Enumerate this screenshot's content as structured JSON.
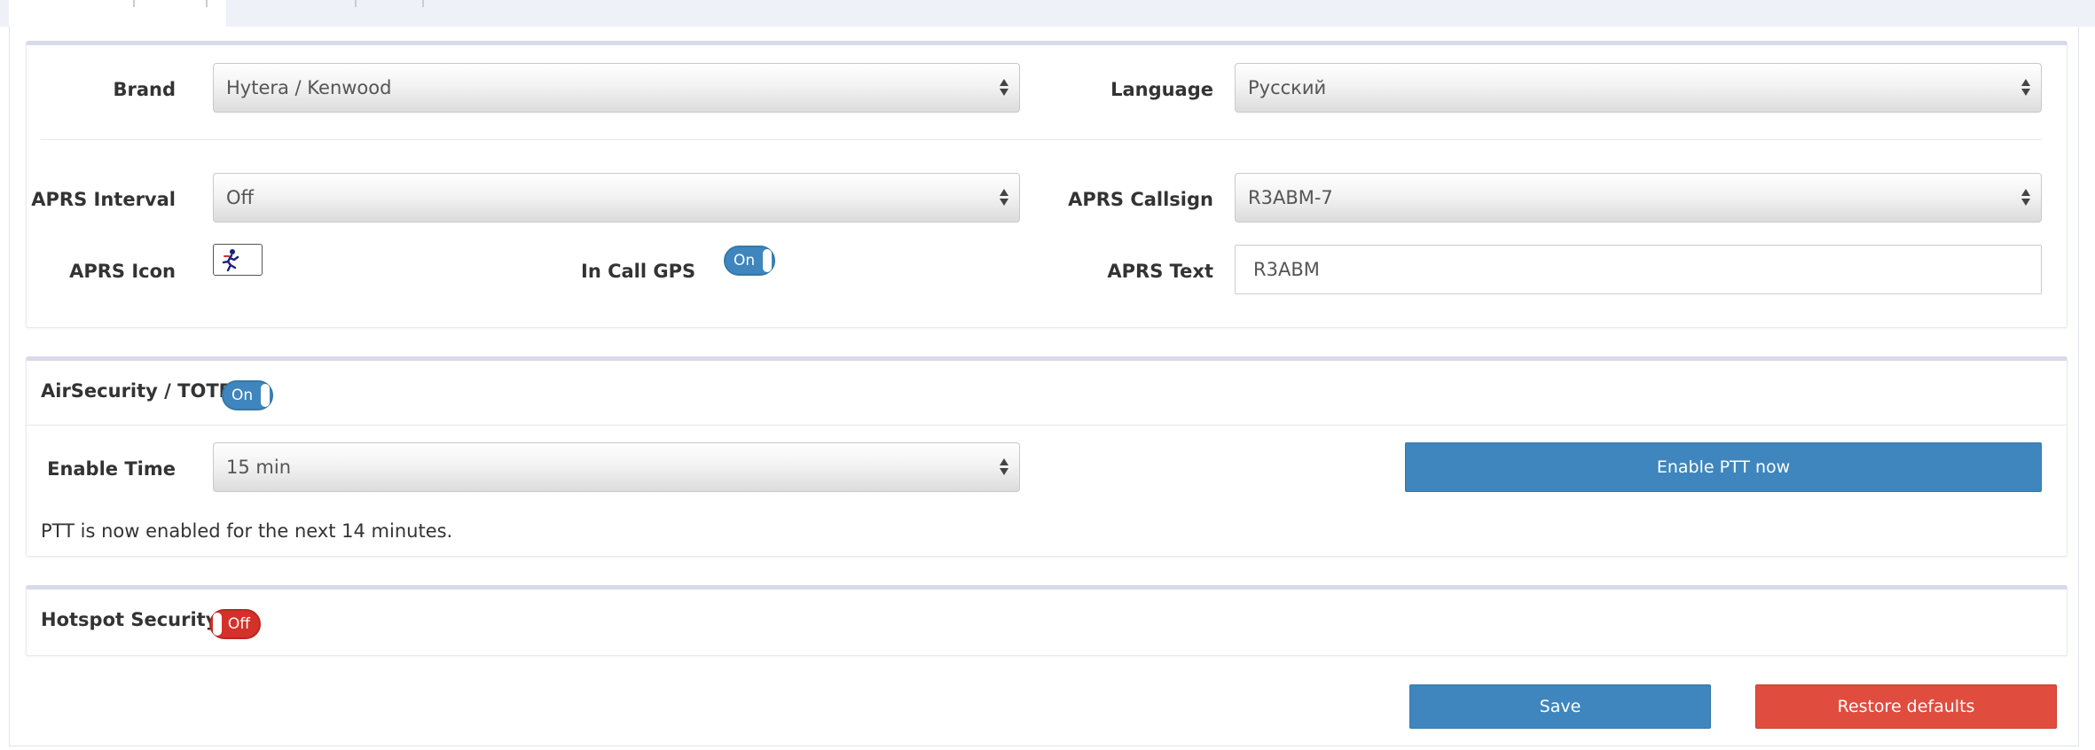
{
  "general": {
    "brand_label": "Brand",
    "brand_value": "Hytera / Kenwood",
    "language_label": "Language",
    "language_value": "Русский",
    "aprs_interval_label": "APRS Interval",
    "aprs_interval_value": "Off",
    "aprs_callsign_label": "APRS Callsign",
    "aprs_callsign_value": "R3ABM-7",
    "aprs_icon_label": "APRS Icon",
    "aprs_icon_name": "running-person-icon",
    "in_call_gps_label": "In Call GPS",
    "in_call_gps_state": "On",
    "aprs_text_label": "APRS Text",
    "aprs_text_value": "R3ABM"
  },
  "air_security": {
    "title": "AirSecurity / TOTP",
    "toggle_state": "On",
    "enable_time_label": "Enable Time",
    "enable_time_value": "15 min",
    "enable_ptt_button": "Enable PTT now",
    "status_message": "PTT is now enabled for the next 14 minutes."
  },
  "hotspot_security": {
    "title": "Hotspot Security",
    "toggle_state": "Off"
  },
  "actions": {
    "save_label": "Save",
    "restore_label": "Restore defaults"
  },
  "colors": {
    "primary": "#3e86bd",
    "danger": "#e04c3e",
    "toggle_off": "#d4312b"
  }
}
